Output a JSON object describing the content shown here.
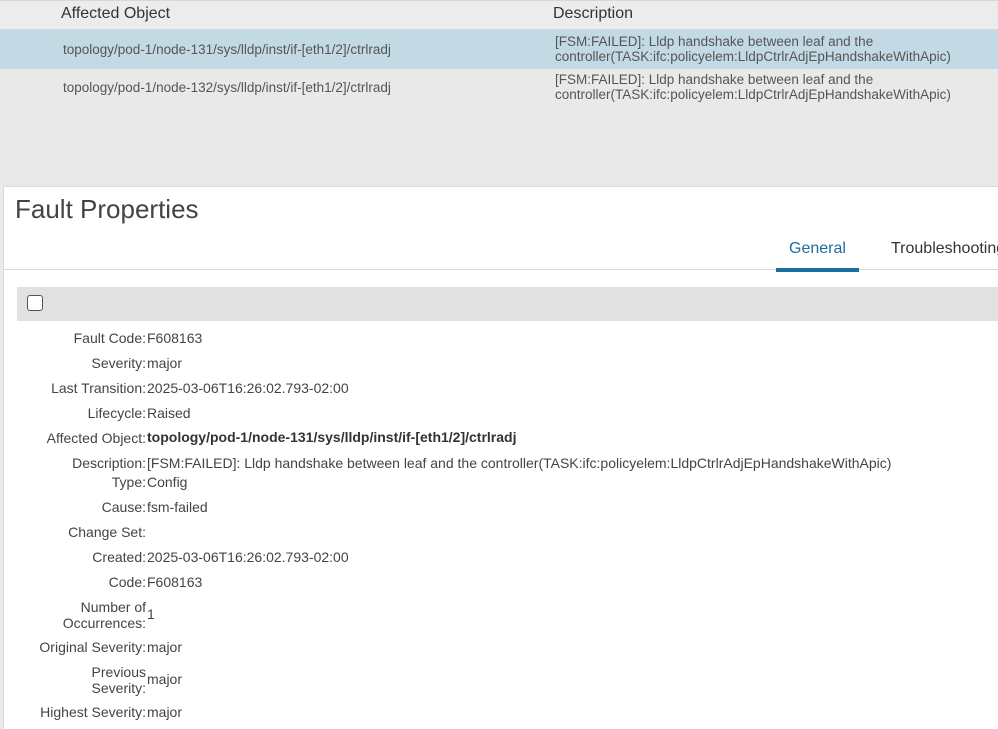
{
  "faults_table": {
    "headers": {
      "affected_object": "Affected Object",
      "description": "Description"
    },
    "rows": [
      {
        "affected_object": "topology/pod-1/node-131/sys/lldp/inst/if-[eth1/2]/ctrlradj",
        "description_line1": "[FSM:FAILED]: Lldp handshake between leaf and the",
        "description_line2": "controller(TASK:ifc:policyelem:LldpCtrlrAdjEpHandshakeWithApic)",
        "selected": true
      },
      {
        "affected_object": "topology/pod-1/node-132/sys/lldp/inst/if-[eth1/2]/ctrlradj",
        "description_line1": "[FSM:FAILED]: Lldp handshake between leaf and the",
        "description_line2": "controller(TASK:ifc:policyelem:LldpCtrlrAdjEpHandshakeWithApic)",
        "selected": false
      }
    ]
  },
  "panel": {
    "title": "Fault Properties",
    "tabs": [
      {
        "label": "General",
        "active": true
      },
      {
        "label": "Troubleshooting",
        "active": false
      }
    ]
  },
  "properties": {
    "fault_code": {
      "label": "Fault Code:",
      "value": "F608163"
    },
    "severity": {
      "label": "Severity:",
      "value": "major"
    },
    "last_transition": {
      "label": "Last Transition:",
      "value": "2025-03-06T16:26:02.793-02:00"
    },
    "lifecycle": {
      "label": "Lifecycle:",
      "value": "Raised"
    },
    "affected_object": {
      "label": "Affected Object:",
      "value": "topology/pod-1/node-131/sys/lldp/inst/if-[eth1/2]/ctrlradj"
    },
    "description": {
      "label": "Description:",
      "value": "[FSM:FAILED]: Lldp handshake between leaf and the controller(TASK:ifc:policyelem:LldpCtrlrAdjEpHandshakeWithApic)"
    },
    "type": {
      "label": "Type:",
      "value": "Config"
    },
    "cause": {
      "label": "Cause:",
      "value": "fsm-failed"
    },
    "change_set": {
      "label": "Change Set:",
      "value": ""
    },
    "created": {
      "label": "Created:",
      "value": "2025-03-06T16:26:02.793-02:00"
    },
    "code": {
      "label": "Code:",
      "value": "F608163"
    },
    "occurrences": {
      "label_line1": "Number of",
      "label_line2": "Occurrences:",
      "value": "1"
    },
    "original_severity": {
      "label": "Original Severity:",
      "value": "major"
    },
    "previous_severity": {
      "label_line1": "Previous",
      "label_line2": "Severity:",
      "value": "major"
    },
    "highest_severity": {
      "label": "Highest Severity:",
      "value": "major"
    }
  },
  "colors": {
    "accent": "#1a6ea0",
    "selected_row": "#c3dae4"
  },
  "icons": {
    "toolbar_checkbox": "checkbox-icon"
  }
}
